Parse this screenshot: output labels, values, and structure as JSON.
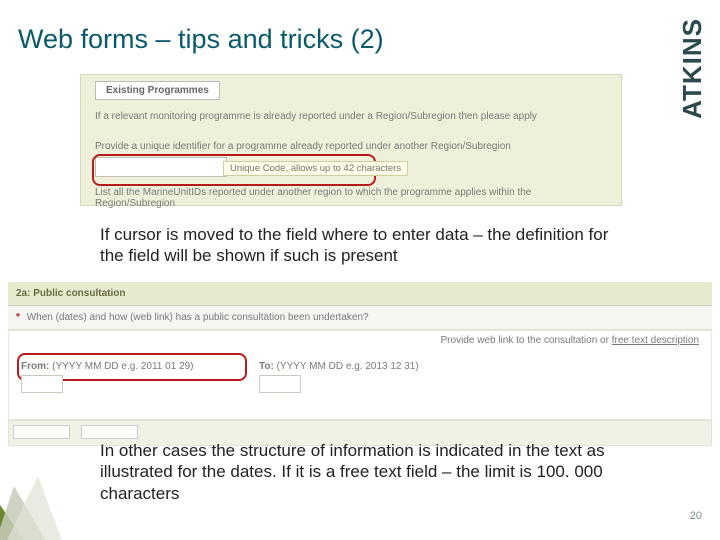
{
  "slide": {
    "title": "Web forms – tips and tricks (2)",
    "logo": "ATKINS",
    "page_number": "20"
  },
  "form1": {
    "tab_label": "Existing Programmes",
    "line1": "If a relevant monitoring programme is already reported under a Region/Subregion then please apply",
    "line2": "Provide a unique identifier for a programme already reported under another Region/Subregion",
    "tooltip": "Unique Code, allows up to 42 characters",
    "line3": "List all the MarineUnitIDs reported under another region to which the programme applies within the Region/Subregion"
  },
  "caption1": "If cursor is moved to the field where to enter data – the definition for the field will be shown if such is present",
  "form2": {
    "section_header": "2a: Public consultation",
    "question": "When (dates) and how (web link) has a public consultation been undertaken?",
    "right_hint_prefix": "Provide web link to the consultation or ",
    "right_hint_link": "free text description",
    "from_label": "From:",
    "from_hint": "(YYYY MM DD e.g. 2011 01 29)",
    "to_label": "To:",
    "to_hint": "(YYYY MM DD e.g. 2013 12 31)"
  },
  "caption2": "In other cases the structure of information is indicated in the text as illustrated for the dates. If it is a free text field – the limit is 100. 000 characters"
}
